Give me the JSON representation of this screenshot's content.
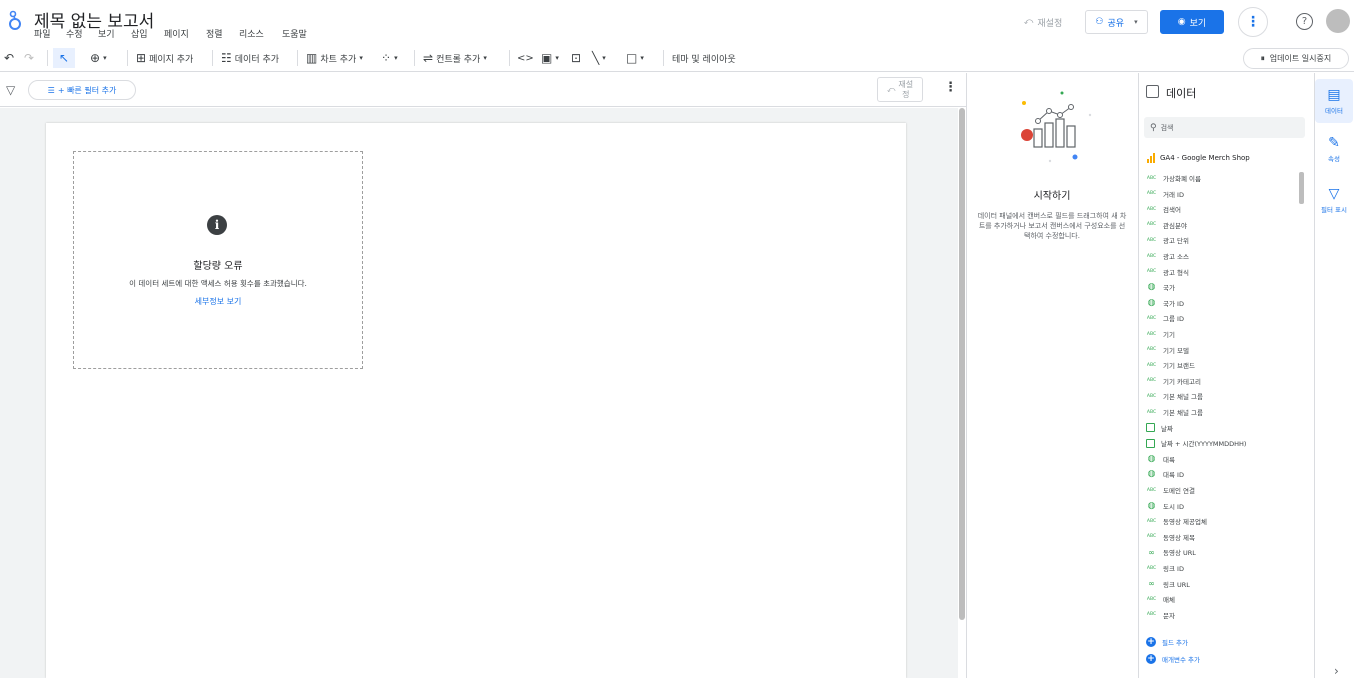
{
  "header": {
    "title": "제목 없는 보고서",
    "menus": [
      "파일",
      "수정",
      "보기",
      "삽입",
      "페이지",
      "정렬",
      "리소스",
      "도움말"
    ],
    "reset_label": "재설정",
    "share_label": "공유",
    "view_label": "보기",
    "more_label": "⋮",
    "help_label": "?"
  },
  "toolbar": {
    "undo": "↶",
    "redo": "↷",
    "select": "↖",
    "zoom": "⊕",
    "add_page": "페이지 추가",
    "add_data": "데이터 추가",
    "add_chart": "차트 추가",
    "add_control": "컨트롤 추가",
    "code": "<>",
    "theme_layout": "테마 및 레이아웃",
    "pause_updates": "업데이트 일시중지"
  },
  "filterbar": {
    "quick_filter": "+ 빠른 필터 추가",
    "reset_line1": "재설",
    "reset_line2": "정"
  },
  "canvas": {
    "error_icon": "i",
    "error_title": "할당량 오류",
    "error_message": "이 데이터 세트에 대한 액세스 허용 횟수를 초과했습니다.",
    "error_link": "세부정보 보기"
  },
  "getting_started": {
    "title": "시작하기",
    "description": "데이터 패널에서 캔버스로 필드를 드래그하여 새 차트를 추가하거나 보고서 캔버스에서 구성요소를 선택하여 수정합니다."
  },
  "data_panel": {
    "title": "데이터",
    "search_placeholder": "검색",
    "source": "GA4 - Google Merch Shop",
    "fields": [
      {
        "type": "abc",
        "name": "가상화폐 이름"
      },
      {
        "type": "abc",
        "name": "거래 ID"
      },
      {
        "type": "abc",
        "name": "검색어"
      },
      {
        "type": "abc",
        "name": "관심분야"
      },
      {
        "type": "abc",
        "name": "광고 단위"
      },
      {
        "type": "abc",
        "name": "광고 소스"
      },
      {
        "type": "abc",
        "name": "광고 형식"
      },
      {
        "type": "globe",
        "name": "국가"
      },
      {
        "type": "globe",
        "name": "국가 ID"
      },
      {
        "type": "abc",
        "name": "그룹 ID"
      },
      {
        "type": "abc",
        "name": "기기"
      },
      {
        "type": "abc",
        "name": "기기 모델"
      },
      {
        "type": "abc",
        "name": "기기 브랜드"
      },
      {
        "type": "abc",
        "name": "기기 카테고리"
      },
      {
        "type": "abc",
        "name": "기본 채널 그룹"
      },
      {
        "type": "abc",
        "name": "기본 채널 그룹"
      },
      {
        "type": "cal",
        "name": "날짜"
      },
      {
        "type": "cal",
        "name": "날짜 + 시간(YYYYMMDDHH)"
      },
      {
        "type": "globe",
        "name": "대륙"
      },
      {
        "type": "globe",
        "name": "대륙 ID"
      },
      {
        "type": "abc",
        "name": "도메인 연결"
      },
      {
        "type": "globe",
        "name": "도시 ID"
      },
      {
        "type": "abc",
        "name": "동영상 제공업체"
      },
      {
        "type": "abc",
        "name": "동영상 제목"
      },
      {
        "type": "link",
        "name": "동영상 URL"
      },
      {
        "type": "abc",
        "name": "링크 ID"
      },
      {
        "type": "link",
        "name": "링크 URL"
      },
      {
        "type": "abc",
        "name": "매체"
      },
      {
        "type": "abc",
        "name": "문자"
      }
    ],
    "add_field": "필드 추가",
    "add_parameter": "매개변수 추가"
  },
  "rail": {
    "data": "데이터",
    "properties": "속성",
    "filter": "필터 표시"
  },
  "colors": {
    "accent": "#1a73e8",
    "field_type": "#34a853",
    "source_bars": "#f9ab00"
  }
}
